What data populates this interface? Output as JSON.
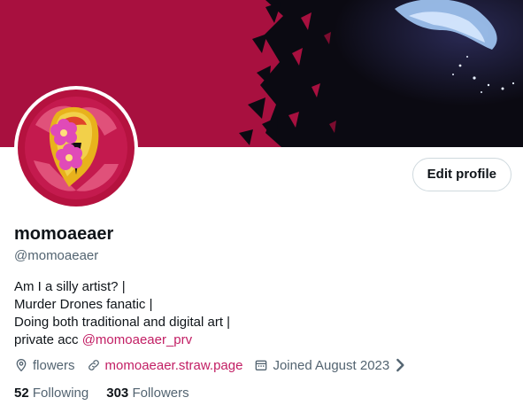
{
  "profile": {
    "display_name": "momoaeaer",
    "handle": "@momoaeaer",
    "edit_button_label": "Edit profile",
    "bio_lines": [
      "Am I a silly artist? |",
      "Murder Drones fanatic |",
      "Doing both traditional and digital art |"
    ],
    "bio_last_prefix": "private acc ",
    "bio_mention": "@momoaeaer_prv",
    "location": "flowers",
    "website": "momoaeaer.straw.page",
    "joined": "Joined August 2023",
    "following_count": "52",
    "following_label": "Following",
    "followers_count": "303",
    "followers_label": "Followers"
  },
  "icons": {
    "location": "location-pin-icon",
    "website": "link-icon",
    "joined": "calendar-icon",
    "more": "chevron-right-icon"
  },
  "colors": {
    "banner_crimson": "#a8103f",
    "banner_dark": "#0b0a12",
    "link": "#c21e64",
    "muted_text": "#536471",
    "primary_text": "#0f1419",
    "border": "#cfd9de"
  }
}
